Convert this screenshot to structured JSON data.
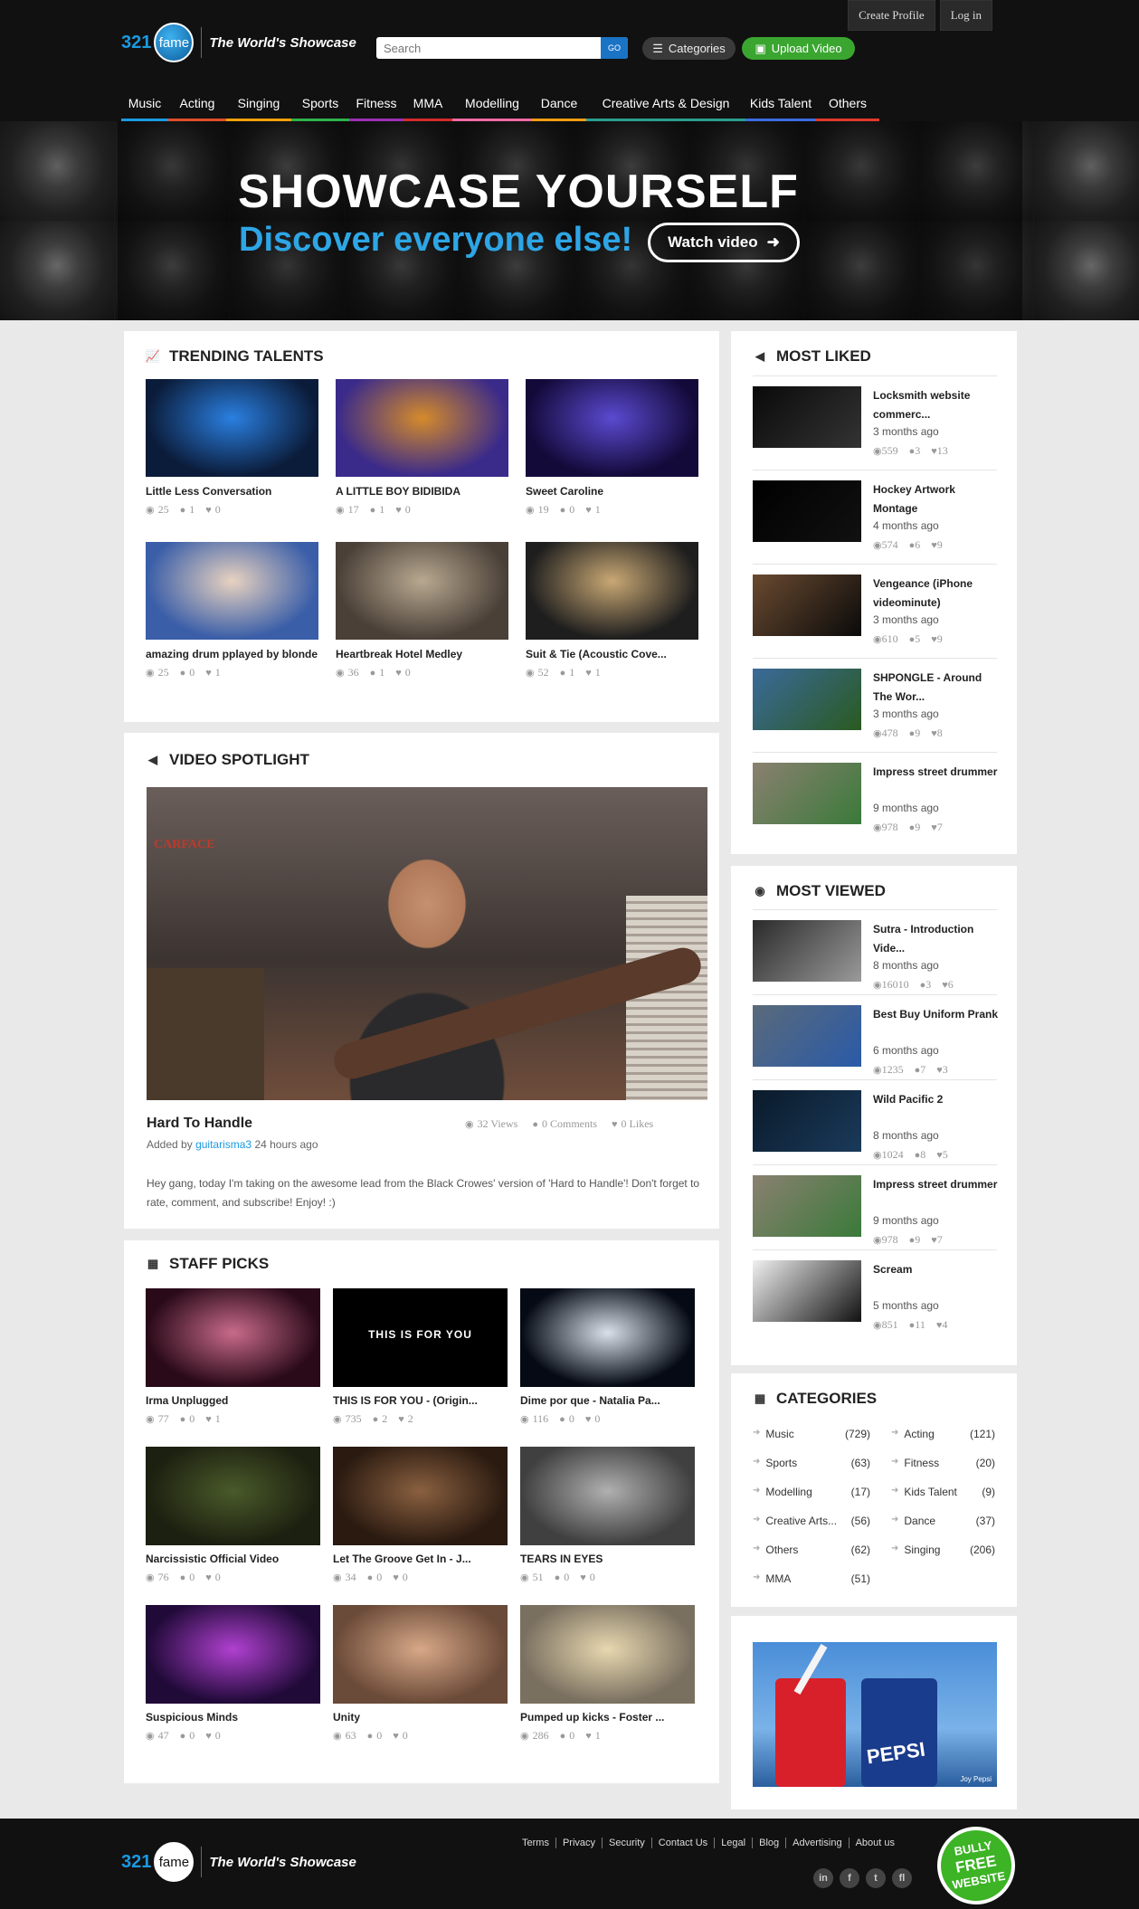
{
  "header": {
    "create_profile": "Create Profile",
    "login": "Log in",
    "logo_number": "321",
    "logo_word": "fame",
    "slogan": "The World's Showcase",
    "search_placeholder": "Search",
    "search_go": "GO",
    "categories_btn": "Categories",
    "upload_btn": "Upload Video"
  },
  "nav": [
    {
      "label": "Music",
      "color": "#1b9ae0"
    },
    {
      "label": "Acting",
      "color": "#e04f2b"
    },
    {
      "label": "Singing",
      "color": "#f1a10b"
    },
    {
      "label": "Sports",
      "color": "#2eb24a"
    },
    {
      "label": "Fitness",
      "color": "#9c2fb8"
    },
    {
      "label": "MMA",
      "color": "#d32a2a"
    },
    {
      "label": "Modelling",
      "color": "#f06aa5"
    },
    {
      "label": "Dance",
      "color": "#f39c12"
    },
    {
      "label": "Creative Arts & Design",
      "color": "#2a9d8f"
    },
    {
      "label": "Kids Talent",
      "color": "#3c6de0"
    },
    {
      "label": "Others",
      "color": "#e0392b"
    }
  ],
  "hero": {
    "title": "SHOWCASE YOURSELF",
    "subtitle": "Discover everyone else!",
    "watch": "Watch video"
  },
  "trending": {
    "title": "TRENDING TALENTS",
    "items": [
      {
        "name": "Little Less Conversation",
        "views": "25",
        "comments": "1",
        "likes": "0",
        "bg": "#0b1c3a",
        "accent": "#2a7fe0"
      },
      {
        "name": "A LITTLE BOY BIDIBIDA",
        "views": "17",
        "comments": "1",
        "likes": "0",
        "bg": "#3a2a8a",
        "accent": "#d58b2a"
      },
      {
        "name": "Sweet Caroline",
        "views": "19",
        "comments": "0",
        "likes": "1",
        "bg": "#140a3a",
        "accent": "#5a4ad0"
      },
      {
        "name": "amazing drum pplayed by blonde",
        "views": "25",
        "comments": "0",
        "likes": "1",
        "bg": "#3a5ea8",
        "accent": "#e8d2c0"
      },
      {
        "name": "Heartbreak Hotel Medley",
        "views": "36",
        "comments": "1",
        "likes": "0",
        "bg": "#4a4038",
        "accent": "#b8a890"
      },
      {
        "name": "Suit & Tie (Acoustic Cove...",
        "views": "52",
        "comments": "1",
        "likes": "1",
        "bg": "#1e1e1e",
        "accent": "#c9a874"
      }
    ]
  },
  "spotlight": {
    "title": "VIDEO SPOTLIGHT",
    "video_title": "Hard To Handle",
    "views": "32 Views",
    "comments": "0 Comments",
    "likes": "0 Likes",
    "added_by_prefix": "Added by",
    "user": "guitarisma3",
    "ago": "24 hours ago",
    "description": "Hey gang, today I'm taking on the awesome lead from the Black Crowes' version of 'Hard to Handle'! Don't forget to rate, comment, and subscribe! Enjoy! :)",
    "poster_label": "CARFACE"
  },
  "staff": {
    "title": "STAFF PICKS",
    "items": [
      {
        "name": "Irma Unplugged",
        "views": "77",
        "comments": "0",
        "likes": "1",
        "bg": "#2a0a18",
        "accent": "#c86a8a",
        "caption": ""
      },
      {
        "name": "THIS IS FOR YOU - (Origin...",
        "views": "735",
        "comments": "2",
        "likes": "2",
        "bg": "#000000",
        "accent": "#000000",
        "caption": "THIS IS FOR YOU"
      },
      {
        "name": "Dime por que - Natalia Pa...",
        "views": "116",
        "comments": "0",
        "likes": "0",
        "bg": "#050a14",
        "accent": "#d8e0ea",
        "caption": ""
      },
      {
        "name": "Narcissistic Official Video",
        "views": "76",
        "comments": "0",
        "likes": "0",
        "bg": "#1c2010",
        "accent": "#4a5a2a",
        "caption": ""
      },
      {
        "name": "Let The Groove Get In - J...",
        "views": "34",
        "comments": "0",
        "likes": "0",
        "bg": "#2a1a10",
        "accent": "#8a6040",
        "caption": ""
      },
      {
        "name": "TEARS IN EYES",
        "views": "51",
        "comments": "0",
        "likes": "0",
        "bg": "#404040",
        "accent": "#b0b0b0",
        "caption": ""
      },
      {
        "name": "Suspicious Minds",
        "views": "47",
        "comments": "0",
        "likes": "0",
        "bg": "#200a38",
        "accent": "#b040d0",
        "caption": ""
      },
      {
        "name": "Unity",
        "views": "63",
        "comments": "0",
        "likes": "0",
        "bg": "#6a4a38",
        "accent": "#d8a888",
        "caption": ""
      },
      {
        "name": "Pumped up kicks - Foster ...",
        "views": "286",
        "comments": "0",
        "likes": "1",
        "bg": "#7a7060",
        "accent": "#e8d8b0",
        "caption": ""
      }
    ]
  },
  "most_liked": {
    "title": "MOST LIKED",
    "items": [
      {
        "title": "Locksmith website commerc...",
        "ago": "3 months ago",
        "views": "559",
        "comments": "3",
        "likes": "13",
        "bg": "#0a0a0a",
        "accent": "#333333"
      },
      {
        "title": "Hockey Artwork Montage",
        "ago": "4 months ago",
        "views": "574",
        "comments": "6",
        "likes": "9",
        "bg": "#000000",
        "accent": "#111111"
      },
      {
        "title": "Vengeance (iPhone videominute)",
        "ago": "3 months ago",
        "views": "610",
        "comments": "5",
        "likes": "9",
        "bg": "#6a4a30",
        "accent": "#0a0a0a"
      },
      {
        "title": "SHPONGLE - Around The Wor...",
        "ago": "3 months ago",
        "views": "478",
        "comments": "9",
        "likes": "8",
        "bg": "#3a6a9a",
        "accent": "#2a5a20"
      },
      {
        "title": "Impress street drummer",
        "ago": "9 months ago",
        "views": "978",
        "comments": "9",
        "likes": "7",
        "bg": "#8a8070",
        "accent": "#3a7a3a"
      }
    ]
  },
  "most_viewed": {
    "title": "MOST VIEWED",
    "items": [
      {
        "title": "Sutra - Introduction Vide...",
        "ago": "8 months ago",
        "views": "16010",
        "comments": "3",
        "likes": "6",
        "bg": "#2a2a2a",
        "accent": "#9a9a9a"
      },
      {
        "title": "Best Buy Uniform Prank",
        "ago": "6 months ago",
        "views": "1235",
        "comments": "7",
        "likes": "3",
        "bg": "#5a6a7a",
        "accent": "#2a5aa8"
      },
      {
        "title": "Wild Pacific 2",
        "ago": "8 months ago",
        "views": "1024",
        "comments": "8",
        "likes": "5",
        "bg": "#0a1a2a",
        "accent": "#1a3a5a"
      },
      {
        "title": "Impress street drummer",
        "ago": "9 months ago",
        "views": "978",
        "comments": "9",
        "likes": "7",
        "bg": "#8a8070",
        "accent": "#3a7a3a"
      },
      {
        "title": "Scream",
        "ago": "5 months ago",
        "views": "851",
        "comments": "11",
        "likes": "4",
        "bg": "#f0f0f0",
        "accent": "#111111"
      }
    ]
  },
  "categories": {
    "title": "CATEGORIES",
    "items": [
      {
        "name": "Music",
        "count": "(729)"
      },
      {
        "name": "Acting",
        "count": "(121)"
      },
      {
        "name": "Sports",
        "count": "(63)"
      },
      {
        "name": "Fitness",
        "count": "(20)"
      },
      {
        "name": "Modelling",
        "count": "(17)"
      },
      {
        "name": "Kids Talent",
        "count": "(9)"
      },
      {
        "name": "Creative Arts...",
        "count": "(56)"
      },
      {
        "name": "Dance",
        "count": "(37)"
      },
      {
        "name": "Others",
        "count": "(62)"
      },
      {
        "name": "Singing",
        "count": "(206)"
      },
      {
        "name": "MMA",
        "count": "(51)"
      }
    ]
  },
  "ad": {
    "brand": "PEPSI",
    "tag": "Joy Pepsi",
    "brand_colors": [
      "#d8202a",
      "#1a3c8c"
    ]
  },
  "footer": {
    "logo_number": "321",
    "logo_word": "fame",
    "slogan": "The World's Showcase",
    "links": [
      "Terms",
      "Privacy",
      "Security",
      "Contact Us",
      "Legal",
      "Blog",
      "Advertising",
      "About us"
    ],
    "social": [
      "in",
      "f",
      "t",
      "fl"
    ],
    "badge_lines": [
      "BULLY",
      "FREE",
      "WEBSITE"
    ]
  }
}
